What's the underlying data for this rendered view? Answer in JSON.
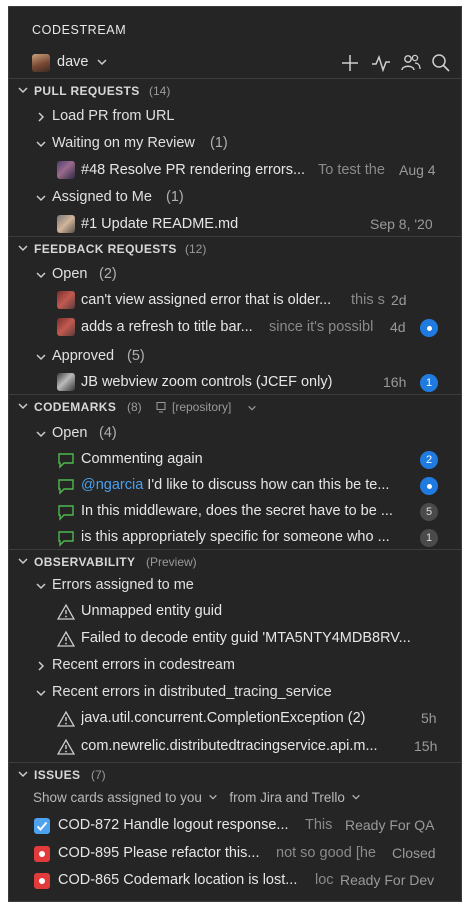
{
  "app": {
    "title": "CODESTREAM"
  },
  "user": {
    "name": "dave"
  },
  "toolbar": {
    "icons": [
      "plus-icon",
      "activity-icon",
      "team-icon",
      "search-icon"
    ]
  },
  "pull_requests": {
    "title": "PULL REQUESTS",
    "count": "(14)",
    "load_label": "Load PR from URL",
    "waiting": {
      "label": "Waiting on my Review",
      "count": "(1)",
      "items": [
        {
          "title": "#48 Resolve PR rendering errors...",
          "snippet": "To test the",
          "date": "Aug 4"
        }
      ]
    },
    "assigned": {
      "label": "Assigned to Me",
      "count": "(1)",
      "items": [
        {
          "title": "#1 Update README.md",
          "date": "Sep 8, '20"
        }
      ]
    }
  },
  "feedback_requests": {
    "title": "FEEDBACK REQUESTS",
    "count": "(12)",
    "open": {
      "label": "Open",
      "count": "(2)",
      "items": [
        {
          "title": "can't view assigned error that is older...",
          "snippet": "this s",
          "date": "2d"
        },
        {
          "title": "adds a refresh to title bar...",
          "snippet": "since it's possibl",
          "date": "4d"
        }
      ]
    },
    "approved": {
      "label": "Approved",
      "count": "(5)",
      "items": [
        {
          "title": "JB webview zoom controls (JCEF only)",
          "date": "16h",
          "badge": "1"
        }
      ]
    }
  },
  "codemarks": {
    "title": "CODEMARKS",
    "count": "(8)",
    "repo": "[repository]",
    "open": {
      "label": "Open",
      "count": "(4)",
      "items": [
        {
          "title": "Commenting again",
          "badge": "2"
        },
        {
          "mention": "@ngarcia",
          "title": " I'd like to discuss how can this be te..."
        },
        {
          "title": "In this middleware, does the secret have to be ...",
          "badge": "5"
        },
        {
          "title": "is this appropriately specific for someone who ...",
          "badge": "1"
        }
      ]
    }
  },
  "observability": {
    "title": "OBSERVABILITY",
    "subtitle": "(Preview)",
    "assigned": {
      "label": "Errors assigned to me",
      "items": [
        {
          "title": "Unmapped entity guid"
        },
        {
          "title": "Failed to decode entity guid 'MTA5NTY4MDB8RV..."
        }
      ]
    },
    "recent_cs": {
      "label": "Recent errors in codestream"
    },
    "recent_dts": {
      "label": "Recent errors in distributed_tracing_service",
      "items": [
        {
          "title": "java.util.concurrent.CompletionException (2)",
          "date": "5h"
        },
        {
          "title": "com.newrelic.distributedtracingservice.api.m...",
          "date": "15h"
        }
      ]
    }
  },
  "issues": {
    "title": "ISSUES",
    "count": "(7)",
    "filter_assigned": "Show cards assigned to you",
    "filter_source": "from Jira and Trello",
    "items": [
      {
        "title": "COD-872 Handle logout response...",
        "snippet": "This",
        "status": "Ready For QA"
      },
      {
        "title": "COD-895 Please refactor this...",
        "snippet": "not so good [he",
        "status": "Closed"
      },
      {
        "title": "COD-865 Codemark location is lost...",
        "snippet": "loc",
        "status": "Ready For Dev"
      }
    ]
  },
  "colors": {
    "background": "#252526",
    "accent_blue": "#1f7be0",
    "codemark_green": "#4fb84f",
    "issue_red": "#e23b3b"
  }
}
